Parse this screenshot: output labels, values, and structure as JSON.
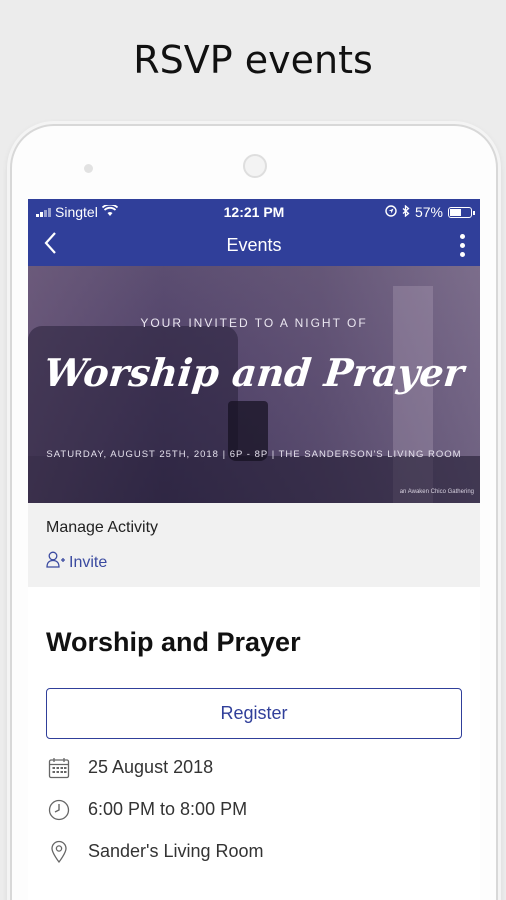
{
  "promo": {
    "title": "RSVP events"
  },
  "status_bar": {
    "carrier": "Singtel",
    "time": "12:21 PM",
    "battery": "57%",
    "battery_level": 0.57
  },
  "app_bar": {
    "title": "Events",
    "color": "#303f9a"
  },
  "banner": {
    "top_text": "YOUR INVITED TO A NIGHT OF",
    "script_text": "Worship and Prayer",
    "bottom_text": "SATURDAY, AUGUST 25TH, 2018 | 6P - 8P | THE SANDERSON'S LIVING ROOM",
    "credit": "an Awaken Chico Gathering"
  },
  "manage": {
    "title": "Manage Activity",
    "invite_label": "Invite"
  },
  "event": {
    "title": "Worship and Prayer",
    "register_label": "Register",
    "date": "25 August 2018",
    "time": "6:00 PM to 8:00 PM",
    "location": "Sander's Living Room"
  },
  "icons": {
    "back": "chevron-left-icon",
    "more": "more-vertical-icon",
    "invite": "person-add-icon",
    "date": "calendar-icon",
    "time": "clock-icon",
    "location": "map-pin-icon"
  }
}
